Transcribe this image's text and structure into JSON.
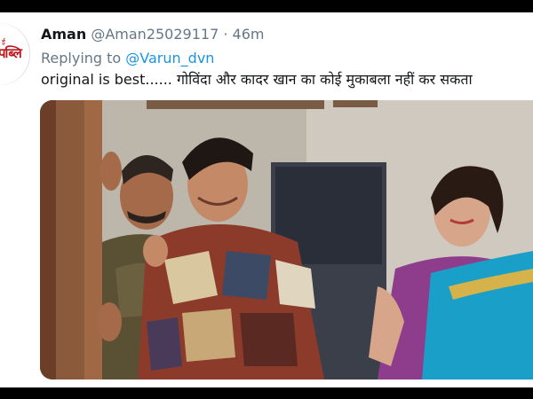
{
  "tweet": {
    "display_name": "Aman",
    "handle": "@Aman25029117",
    "separator": "·",
    "time": "46m",
    "reply_prefix": "Replying to",
    "reply_to": "@Varun_dvn",
    "text": "original is best...... गोविंदा और कादर खान का कोई मुकाबला नहीं कर सकता",
    "avatar_text": "पब्लि",
    "avatar_small": "ई"
  },
  "colors": {
    "name": "#14171a",
    "secondary": "#657786",
    "link": "#1b95e0",
    "avatar_brand": "#c0151b",
    "frame": "#000000"
  },
  "icons": {
    "media": "photo"
  }
}
